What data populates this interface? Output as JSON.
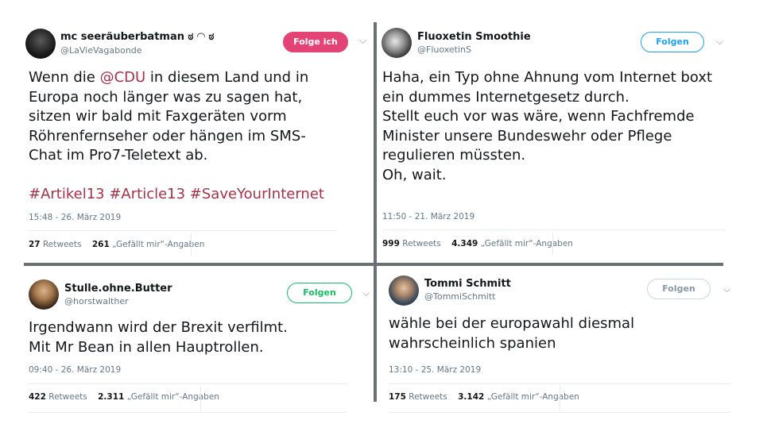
{
  "tweets": [
    {
      "name": "mc seeräuberbatman ಠ ◠ ಠ",
      "handle": "@LaVieVagabonde",
      "button": "Folge ich",
      "text_before": "Wenn die ",
      "mention": "@CDU",
      "text_after": " in diesem Land und in\nEuropa noch länger was zu sagen hat,\nsitzen wir bald mit Faxgeräten vorm\nRöhrenfernseher oder hängen im SMS-\nChat im Pro7-Teletext ab.",
      "hashtags": "#Artikel13 #Article13 #SaveYourInternet",
      "time": "15:48 - 26. März 2019",
      "retweets": "27",
      "retweets_label": "Retweets",
      "likes": "261",
      "likes_label": "„Gefällt mir“-Angaben"
    },
    {
      "name": "Fluoxetin Smoothie",
      "handle": "@FluoxetinS",
      "button": "Folgen",
      "text": "Haha, ein Typ ohne Ahnung vom Internet boxt\nein dummes Internetgesetz durch.\nStellt euch vor was wäre, wenn Fachfremde\nMinister unsere Bundeswehr oder Pflege\nregulieren müssten.\nOh, wait.",
      "time": "11:50 - 21. März 2019",
      "retweets": "999",
      "retweets_label": "Retweets",
      "likes": "4.349",
      "likes_label": "„Gefällt mir“-Angaben"
    },
    {
      "name": "Stulle.ohne.Butter",
      "handle": "@horstwalther",
      "button": "Folgen",
      "text": "Irgendwann wird der Brexit verfilmt.\nMit Mr Bean in allen Hauptrollen.",
      "time": "09:40 - 26. März 2019",
      "retweets": "422",
      "retweets_label": "Retweets",
      "likes": "2.311",
      "likes_label": "„Gefällt mir“-Angaben"
    },
    {
      "name": "Tommi Schmitt",
      "handle": "@TommiSchmitt",
      "button": "Folgen",
      "text": "wähle bei der europawahl diesmal\nwahrscheinlich spanien",
      "time": "13:10 - 25. März 2019",
      "retweets": "175",
      "retweets_label": "Retweets",
      "likes": "3.142",
      "likes_label": "„Gefällt mir“-Angaben"
    }
  ],
  "colors": {
    "link": "#a3324a",
    "follow_blue": "#1da1f2",
    "following_red": "#e0245e",
    "follow_green": "#17bf63",
    "divider": "#6b6e72"
  },
  "icons": {
    "menu": "chevron-down-icon"
  }
}
